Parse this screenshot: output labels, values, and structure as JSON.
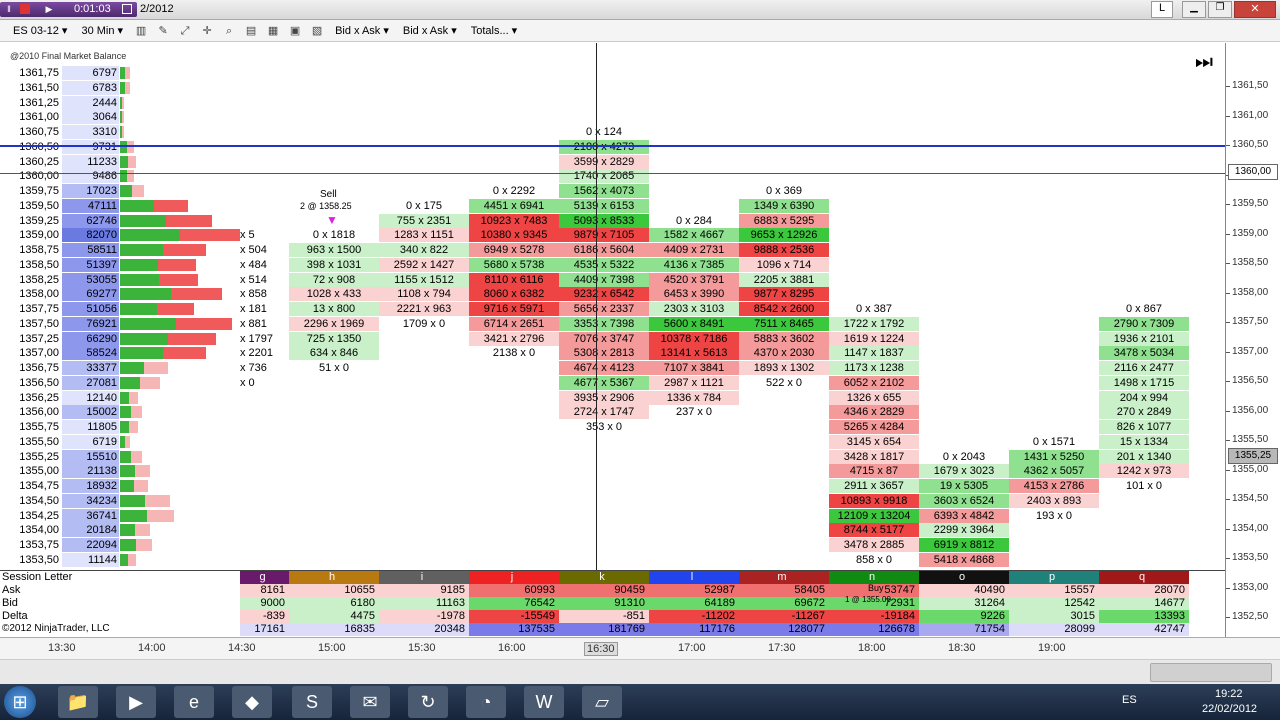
{
  "window": {
    "timer": "0:01:03",
    "date_fragment": "2/2012",
    "l_button": "L"
  },
  "toolbar": {
    "instrument": "ES 03-12",
    "period": "30 Min",
    "bid_ask_1": "Bid x Ask",
    "bid_ask_2": "Bid x Ask",
    "totals": "Totals...",
    "indicator_label": "@2010 Final Market Balance"
  },
  "price_axis": {
    "ticks": [
      "1361,50",
      "1361,00",
      "1360,50",
      "1360,00",
      "1359,50",
      "1359,00",
      "1358,50",
      "1358,00",
      "1357,50",
      "1357,00",
      "1356,50",
      "1356,00",
      "1355,50",
      "1355,00",
      "1354,50",
      "1354,00",
      "1353,50",
      "1353,00",
      "1352,50"
    ],
    "label_current": "1360,00",
    "label_last": "1355,25"
  },
  "profile": [
    {
      "price": "1361,75",
      "vol": "6797"
    },
    {
      "price": "1361,50",
      "vol": "6783"
    },
    {
      "price": "1361,25",
      "vol": "2444"
    },
    {
      "price": "1361,00",
      "vol": "3064"
    },
    {
      "price": "1360,75",
      "vol": "3310"
    },
    {
      "price": "1360,50",
      "vol": "9731"
    },
    {
      "price": "1360,25",
      "vol": "11233"
    },
    {
      "price": "1360,00",
      "vol": "9486"
    },
    {
      "price": "1359,75",
      "vol": "17023"
    },
    {
      "price": "1359,50",
      "vol": "47111"
    },
    {
      "price": "1359,25",
      "vol": "62746"
    },
    {
      "price": "1359,00",
      "vol": "82070"
    },
    {
      "price": "1358,75",
      "vol": "58511"
    },
    {
      "price": "1358,50",
      "vol": "51397"
    },
    {
      "price": "1358,25",
      "vol": "53055"
    },
    {
      "price": "1358,00",
      "vol": "69277"
    },
    {
      "price": "1357,75",
      "vol": "51056"
    },
    {
      "price": "1357,50",
      "vol": "76921"
    },
    {
      "price": "1357,25",
      "vol": "66290"
    },
    {
      "price": "1357,00",
      "vol": "58524"
    },
    {
      "price": "1356,75",
      "vol": "33377"
    },
    {
      "price": "1356,50",
      "vol": "27081"
    },
    {
      "price": "1356,25",
      "vol": "12140"
    },
    {
      "price": "1356,00",
      "vol": "15002"
    },
    {
      "price": "1355,75",
      "vol": "11805"
    },
    {
      "price": "1355,50",
      "vol": "6719"
    },
    {
      "price": "1355,25",
      "vol": "15510"
    },
    {
      "price": "1355,00",
      "vol": "21138"
    },
    {
      "price": "1354,75",
      "vol": "18932"
    },
    {
      "price": "1354,50",
      "vol": "34234"
    },
    {
      "price": "1354,25",
      "vol": "36741"
    },
    {
      "price": "1354,00",
      "vol": "20184"
    },
    {
      "price": "1353,75",
      "vol": "22094"
    },
    {
      "price": "1353,50",
      "vol": "11144"
    }
  ],
  "annotations": {
    "sell_label": "Sell",
    "sell_detail": "2 @ 1358.25",
    "buy_label": "Buy",
    "buy_detail": "1 @ 1355.00"
  },
  "columns": [
    {
      "letter": "g",
      "cells": [
        [
          "1359,00",
          "x 5"
        ],
        [
          "1358,75",
          "x 504"
        ],
        [
          "1358,50",
          "x 484"
        ],
        [
          "1358,25",
          "x 514"
        ],
        [
          "1358,00",
          "x 858"
        ],
        [
          "1357,75",
          "x 181"
        ],
        [
          "1357,50",
          "x 881"
        ],
        [
          "1357,25",
          "x 1797"
        ],
        [
          "1357,00",
          "x 2201"
        ],
        [
          "1356,75",
          "x 736"
        ],
        [
          "1356,50",
          "x 0"
        ]
      ]
    },
    {
      "letter": "h",
      "cells": [
        [
          "1359,00",
          "0 x 1818"
        ],
        [
          "1358,75",
          "963 x 1500"
        ],
        [
          "1358,50",
          "398 x 1031"
        ],
        [
          "1358,25",
          "72 x 908"
        ],
        [
          "1358,00",
          "1028 x 433"
        ],
        [
          "1357,75",
          "13 x 800"
        ],
        [
          "1357,50",
          "2296 x 1969"
        ],
        [
          "1357,25",
          "725 x 1350"
        ],
        [
          "1357,00",
          "634 x 846"
        ],
        [
          "1356,75",
          "51 x 0"
        ]
      ]
    },
    {
      "letter": "i",
      "cells": [
        [
          "1359,50",
          "0 x 175"
        ],
        [
          "1359,25",
          "755 x 2351"
        ],
        [
          "1359,00",
          "1283 x 1151"
        ],
        [
          "1358,75",
          "340 x 822"
        ],
        [
          "1358,50",
          "2592 x 1427"
        ],
        [
          "1358,25",
          "1155 x 1512"
        ],
        [
          "1358,00",
          "1108 x 794"
        ],
        [
          "1357,75",
          "2221 x 963"
        ],
        [
          "1357,50",
          "1709 x 0"
        ]
      ]
    },
    {
      "letter": "j",
      "cells": [
        [
          "1359,75",
          "0 x 2292"
        ],
        [
          "1359,50",
          "4451 x 6941"
        ],
        [
          "1359,25",
          "10923 x 7483"
        ],
        [
          "1359,00",
          "10380 x 9345"
        ],
        [
          "1358,75",
          "6949 x 5278"
        ],
        [
          "1358,50",
          "5680 x 5738"
        ],
        [
          "1358,25",
          "8110 x 6116"
        ],
        [
          "1358,00",
          "8060 x 6382"
        ],
        [
          "1357,75",
          "9716 x 5971"
        ],
        [
          "1357,50",
          "6714 x 2651"
        ],
        [
          "1357,25",
          "3421 x 2796"
        ],
        [
          "1357,00",
          "2138 x 0"
        ]
      ]
    },
    {
      "letter": "k",
      "cells": [
        [
          "1360,75",
          "0 x 124"
        ],
        [
          "1360,50",
          "2180 x 4273"
        ],
        [
          "1360,25",
          "3599 x 2829"
        ],
        [
          "1360,00",
          "1740 x 2065"
        ],
        [
          "1359,75",
          "1562 x 4073"
        ],
        [
          "1359,50",
          "5139 x 6153"
        ],
        [
          "1359,25",
          "5093 x 8533"
        ],
        [
          "1359,00",
          "9879 x 7105"
        ],
        [
          "1358,75",
          "6186 x 5604"
        ],
        [
          "1358,50",
          "4535 x 5322"
        ],
        [
          "1358,25",
          "4409 x 7398"
        ],
        [
          "1358,00",
          "9232 x 6542"
        ],
        [
          "1357,75",
          "5656 x 2337"
        ],
        [
          "1357,50",
          "3353 x 7398"
        ],
        [
          "1357,25",
          "7076 x 3747"
        ],
        [
          "1357,00",
          "5308 x 2813"
        ],
        [
          "1356,75",
          "4674 x 4123"
        ],
        [
          "1356,50",
          "4677 x 5367"
        ],
        [
          "1356,25",
          "3935 x 2906"
        ],
        [
          "1356,00",
          "2724 x 1747"
        ],
        [
          "1355,75",
          "353 x 0"
        ]
      ]
    },
    {
      "letter": "l",
      "cells": [
        [
          "1359,25",
          "0 x 284"
        ],
        [
          "1359,00",
          "1582 x 4667"
        ],
        [
          "1358,75",
          "4409 x 2731"
        ],
        [
          "1358,50",
          "4136 x 7385"
        ],
        [
          "1358,25",
          "4520 x 3791"
        ],
        [
          "1358,00",
          "6453 x 3990"
        ],
        [
          "1357,75",
          "2303 x 3103"
        ],
        [
          "1357,50",
          "5600 x 8491"
        ],
        [
          "1357,25",
          "10378 x 7186"
        ],
        [
          "1357,00",
          "13141 x 5613"
        ],
        [
          "1356,75",
          "7107 x 3841"
        ],
        [
          "1356,50",
          "2987 x 1121"
        ],
        [
          "1356,25",
          "1336 x 784"
        ],
        [
          "1356,00",
          "237 x 0"
        ]
      ]
    },
    {
      "letter": "m",
      "cells": [
        [
          "1359,75",
          "0 x 369"
        ],
        [
          "1359,50",
          "1349 x 6390"
        ],
        [
          "1359,25",
          "6883 x 5295"
        ],
        [
          "1359,00",
          "9653 x 12926"
        ],
        [
          "1358,75",
          "9888 x 2536"
        ],
        [
          "1358,50",
          "1096 x 714"
        ],
        [
          "1358,25",
          "2205 x 3881"
        ],
        [
          "1358,00",
          "9877 x 8295"
        ],
        [
          "1357,75",
          "8542 x 2600"
        ],
        [
          "1357,50",
          "7511 x 8465"
        ],
        [
          "1357,25",
          "5883 x 3602"
        ],
        [
          "1357,00",
          "4370 x 2030"
        ],
        [
          "1356,75",
          "1893 x 1302"
        ],
        [
          "1356,50",
          "522 x 0"
        ]
      ]
    },
    {
      "letter": "n",
      "cells": [
        [
          "1357,75",
          "0 x 387"
        ],
        [
          "1357,50",
          "1722 x 1792"
        ],
        [
          "1357,25",
          "1619 x 1224"
        ],
        [
          "1357,00",
          "1147 x 1837"
        ],
        [
          "1356,75",
          "1173 x 1238"
        ],
        [
          "1356,50",
          "6052 x 2102"
        ],
        [
          "1356,25",
          "1326 x 655"
        ],
        [
          "1356,00",
          "4346 x 2829"
        ],
        [
          "1355,75",
          "5265 x 4284"
        ],
        [
          "1355,50",
          "3145 x 654"
        ],
        [
          "1355,25",
          "3428 x 1817"
        ],
        [
          "1355,00",
          "4715 x 87"
        ],
        [
          "1354,75",
          "2911 x 3657"
        ],
        [
          "1354,50",
          "10893 x 9918"
        ],
        [
          "1354,25",
          "12109 x 13204"
        ],
        [
          "1354,00",
          "8744 x 5177"
        ],
        [
          "1353,75",
          "3478 x 2885"
        ],
        [
          "1353,50",
          "858 x 0"
        ]
      ]
    },
    {
      "letter": "o",
      "cells": [
        [
          "1355,25",
          "0 x 2043"
        ],
        [
          "1355,00",
          "1679 x 3023"
        ],
        [
          "1354,75",
          "19 x 5305"
        ],
        [
          "1354,50",
          "3603 x 6524"
        ],
        [
          "1354,25",
          "6393 x 4842"
        ],
        [
          "1354,00",
          "2299 x 3964"
        ],
        [
          "1353,75",
          "6919 x 8812"
        ],
        [
          "1353,50",
          "5418 x 4868"
        ]
      ]
    },
    {
      "letter": "p",
      "cells": [
        [
          "1355,50",
          "0 x 1571"
        ],
        [
          "1355,25",
          "1431 x 5250"
        ],
        [
          "1355,00",
          "4362 x 5057"
        ],
        [
          "1354,75",
          "4153 x 2786"
        ],
        [
          "1354,50",
          "2403 x 893"
        ],
        [
          "1354,25",
          "193 x 0"
        ]
      ]
    },
    {
      "letter": "q",
      "cells": [
        [
          "1357,75",
          "0 x 867"
        ],
        [
          "1357,50",
          "2790 x 7309"
        ],
        [
          "1357,25",
          "1936 x 2101"
        ],
        [
          "1357,00",
          "3478 x 5034"
        ],
        [
          "1356,75",
          "2116 x 2477"
        ],
        [
          "1356,50",
          "1498 x 1715"
        ],
        [
          "1356,25",
          "204 x 994"
        ],
        [
          "1356,00",
          "270 x 2849"
        ],
        [
          "1355,75",
          "826 x 1077"
        ],
        [
          "1355,50",
          "15 x 1334"
        ],
        [
          "1355,25",
          "201 x 1340"
        ],
        [
          "1355,00",
          "1242 x 973"
        ],
        [
          "1354,75",
          "101 x 0"
        ]
      ]
    }
  ],
  "bottom_rows": {
    "labels": [
      "Session Letter",
      "Ask",
      "Bid",
      "Delta",
      "Volume"
    ],
    "copyright": "©2012 NinjaTrader, LLC",
    "letters": [
      "g",
      "h",
      "i",
      "j",
      "k",
      "l",
      "m",
      "n",
      "o",
      "p",
      "q"
    ],
    "ask": [
      "8161",
      "10655",
      "9185",
      "60993",
      "90459",
      "52987",
      "58405",
      "53747",
      "40490",
      "15557",
      "28070"
    ],
    "bid": [
      "9000",
      "6180",
      "11163",
      "76542",
      "91310",
      "64189",
      "69672",
      "72931",
      "31264",
      "12542",
      "14677"
    ],
    "delta": [
      "-839",
      "4475",
      "-1978",
      "-15549",
      "-851",
      "-11202",
      "-11267",
      "-19184",
      "9226",
      "3015",
      "13393"
    ],
    "volume": [
      "17161",
      "16835",
      "20348",
      "137535",
      "181769",
      "117176",
      "128077",
      "126678",
      "71754",
      "28099",
      "42747"
    ]
  },
  "time_axis": [
    "13:30",
    "14:00",
    "14:30",
    "15:00",
    "15:30",
    "16:00",
    "16:30",
    "17:00",
    "17:30",
    "18:00",
    "18:30",
    "19:00"
  ],
  "taskbar": {
    "lang": "ES",
    "time": "19:22",
    "date": "22/02/2012"
  }
}
